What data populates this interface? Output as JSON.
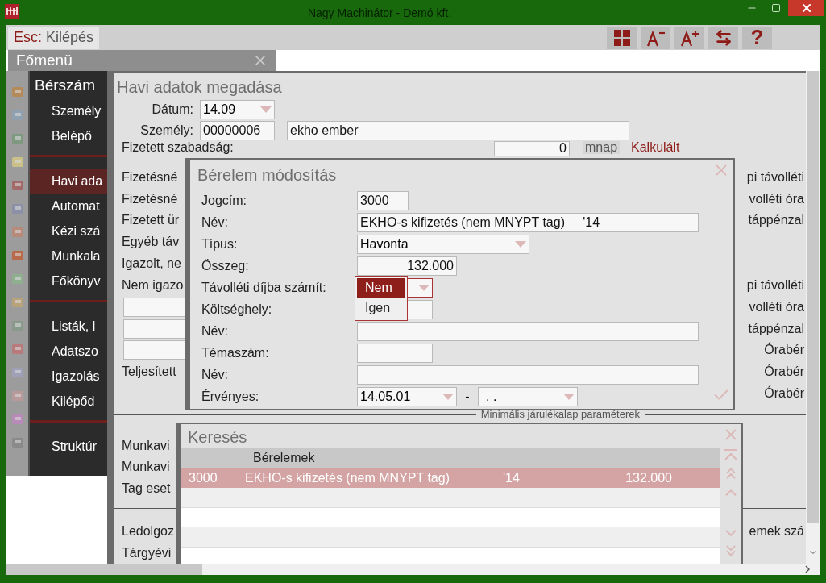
{
  "window": {
    "title": "Nagy Machinátor - Demó kft."
  },
  "toolbar": {
    "escape": {
      "key": "Esc:",
      "label": "Kilépés"
    },
    "tools": [
      {
        "kind": "grid"
      },
      {
        "kind": "font-smaller"
      },
      {
        "kind": "font-larger"
      },
      {
        "kind": "swap"
      },
      {
        "kind": "help",
        "label": "?"
      }
    ]
  },
  "main_tab": {
    "label": "Főmenü"
  },
  "menu": {
    "title": "Bérszám",
    "sections": [
      {
        "items": [
          {
            "label": "Személy",
            "selected": false
          },
          {
            "label": "Belépő",
            "selected": false
          }
        ]
      },
      {
        "items": [
          {
            "label": "Havi ada",
            "selected": true
          },
          {
            "label": "Automat",
            "selected": false
          },
          {
            "label": "Kézi szá",
            "selected": false
          },
          {
            "label": "Munkala",
            "selected": false
          },
          {
            "label": "Főkönyv",
            "selected": false
          }
        ]
      },
      {
        "items": [
          {
            "label": "Listák, l",
            "selected": false
          },
          {
            "label": "Adatszo",
            "selected": false
          },
          {
            "label": "Igazolás",
            "selected": false
          },
          {
            "label": "Kilépőd",
            "selected": false
          }
        ]
      },
      {
        "items": [
          {
            "label": "Struktúr",
            "selected": false
          }
        ]
      }
    ]
  },
  "form": {
    "title": "Havi adatok megadása",
    "date": {
      "label": "Dátum:",
      "value": "14.09"
    },
    "person": {
      "label": "Személy:",
      "id": "00000006",
      "name": "ekho ember"
    },
    "vacation": {
      "label": "Fizetett szabadság:",
      "value": "0",
      "unit": "mnap",
      "link": "Kalkulált"
    },
    "rows": [
      {
        "kind": "label",
        "text": "Fizetésné",
        "right": "pi távolléti"
      },
      {
        "kind": "label",
        "text": "Fizetésné",
        "right": "volléti óra"
      },
      {
        "kind": "label",
        "text": "Fizetett ür",
        "right": "táppénzal"
      },
      {
        "kind": "label",
        "text": "Egyéb táv"
      },
      {
        "kind": "label",
        "text": "Igazolt, ne"
      },
      {
        "kind": "label",
        "text": "Nem igazo",
        "right": "pi távolléti"
      },
      {
        "kind": "input",
        "right": "volléti óra"
      },
      {
        "kind": "input",
        "right": "táppénzal"
      },
      {
        "kind": "input",
        "right": "Órabér"
      },
      {
        "kind": "label",
        "text": "Teljesített",
        "right": "Órabér"
      },
      {
        "kind": "empty",
        "right": "Órabér"
      }
    ],
    "section_legend": "Minimális járulékalap paraméterek",
    "section_rows": [
      "Munkavi",
      "Munkavi",
      "Tag eset"
    ],
    "lower_rows": [
      {
        "text": "Ledolgoz",
        "right": "emek szá"
      },
      {
        "text": "Tárgyévi"
      }
    ]
  },
  "edit_dialog": {
    "title": "Bérelem módosítás",
    "fields": [
      {
        "label": "Jogcím:",
        "kind": "input",
        "value": "3000"
      },
      {
        "label": "Név:",
        "kind": "input",
        "value": "EKHO-s kifizetés (nem MNYPT tag)     '14"
      },
      {
        "label": "Típus:",
        "kind": "select",
        "value": "Havonta"
      },
      {
        "label": "Összeg:",
        "kind": "number",
        "value": "132.000"
      },
      {
        "label": "Távolléti díjba számít:",
        "kind": "select",
        "open": true,
        "options": [
          {
            "label": "Nem",
            "selected": true
          },
          {
            "label": "Igen",
            "selected": false
          }
        ]
      },
      {
        "label": "Költséghely:",
        "kind": "input"
      },
      {
        "label": "Név:",
        "kind": "input"
      },
      {
        "label": "Témaszám:",
        "kind": "input"
      },
      {
        "label": "Név:",
        "kind": "input"
      },
      {
        "label": "Érvényes:",
        "kind": "range",
        "from": "14.05.01",
        "separator": "-",
        "to": ". ."
      }
    ]
  },
  "search_dialog": {
    "title": "Keresés",
    "header": "Bérelemek",
    "rows": [
      {
        "cells": [
          "3000",
          "EKHO-s kifizetés (nem MNYPT tag)",
          "'14",
          "132.000"
        ],
        "selected": true
      }
    ]
  }
}
